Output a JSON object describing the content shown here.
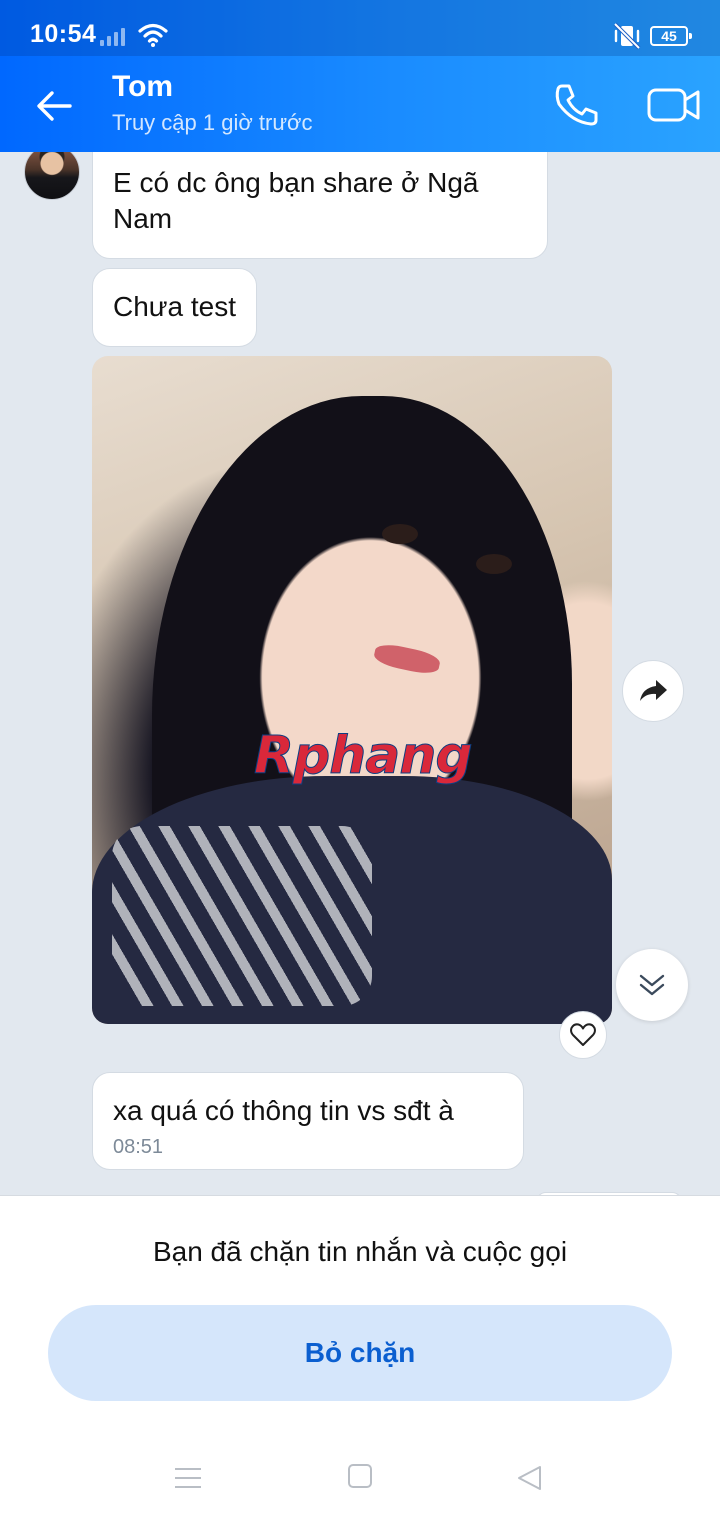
{
  "status_bar": {
    "time": "10:54",
    "battery": "45"
  },
  "header": {
    "name": "Tom",
    "status": "Truy cập 1 giờ trước"
  },
  "messages": [
    {
      "text": "E có dc ông bạn share ở Ngã Nam"
    },
    {
      "text": "Chưa test"
    },
    {
      "image_watermark": "Rphang"
    },
    {
      "text": "xa quá có thông tin vs sđt à",
      "time": "08:51"
    }
  ],
  "footer": {
    "blocked_text": "Bạn đã chặn tin nhắn và cuộc gọi",
    "unblock_label": "Bỏ chặn"
  },
  "colors": {
    "header_start": "#0068ff",
    "header_end": "#2aa3ff",
    "chat_bg": "#e2e8ef",
    "unblock_bg": "#d5e6fb",
    "unblock_text": "#0b5fd0"
  }
}
